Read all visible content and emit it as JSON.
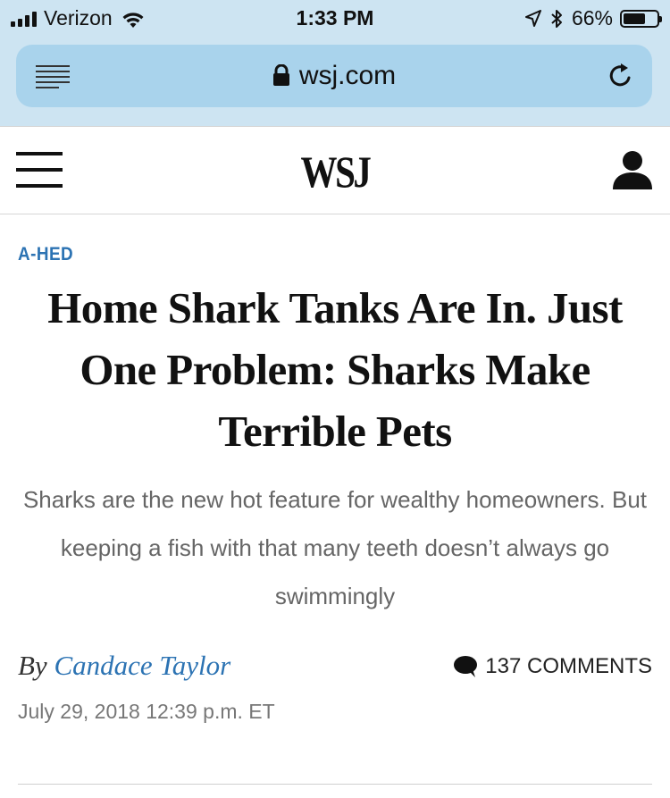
{
  "status_bar": {
    "carrier": "Verizon",
    "time": "1:33 PM",
    "battery_percent_label": "66%",
    "battery_level": 0.66
  },
  "browser": {
    "url": "wsj.com"
  },
  "site_header": {
    "logo": "WSJ"
  },
  "article": {
    "section": "A-HED",
    "headline": "Home Shark Tanks Are In. Just One Problem: Sharks Make Terrible Pets",
    "dek": "Sharks are the new hot feature for wealthy homeowners. But keeping a fish with that many teeth doesn’t always go swimmingly",
    "byline_prefix": "By",
    "author": "Candace Taylor",
    "comments_label": "137 COMMENTS",
    "timestamp": "July 29, 2018 12:39 p.m. ET"
  },
  "colors": {
    "browser_chrome_bg": "#cde4f2",
    "url_field_bg": "#a9d3ec",
    "section_link": "#2c73b3",
    "dek_text": "#666666"
  },
  "icons": [
    "signal-icon",
    "wifi-icon",
    "location-icon",
    "bluetooth-icon",
    "battery-icon",
    "reader-mode-icon",
    "lock-icon",
    "reload-icon",
    "menu-icon",
    "account-icon",
    "comment-icon"
  ]
}
